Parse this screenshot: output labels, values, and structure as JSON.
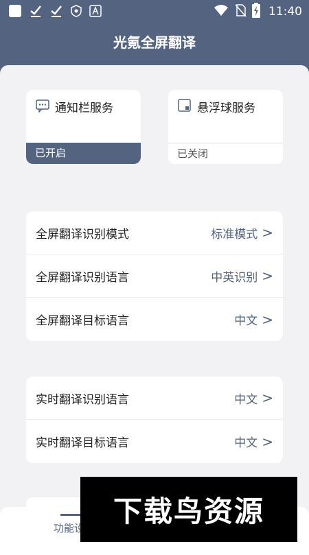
{
  "status_bar": {
    "time": "11:40",
    "left_icons": [
      "square-icon",
      "check-icon",
      "check-icon",
      "shield-icon",
      "a-icon"
    ],
    "right_icons": [
      "wifi-icon",
      "no-sim-icon",
      "battery-charging-icon"
    ]
  },
  "title": "光氪全屏翻译",
  "services": [
    {
      "title": "通知栏服务",
      "status": "已开启",
      "icon": "chat-icon"
    },
    {
      "title": "悬浮球服务",
      "status": "已关闭",
      "icon": "float-ball-icon"
    }
  ],
  "fullscreen_settings": [
    {
      "label": "全屏翻译识别模式",
      "value": "标准模式"
    },
    {
      "label": "全屏翻译识别语言",
      "value": "中英识别"
    },
    {
      "label": "全屏翻译目标语言",
      "value": "中文"
    }
  ],
  "realtime_settings": [
    {
      "label": "实时翻译识别语言",
      "value": "中文"
    },
    {
      "label": "实时翻译目标语言",
      "value": "中文"
    }
  ],
  "chevron": ">",
  "bottom_nav": {
    "tab_label": "功能设"
  },
  "watermark": "下载鸟资源",
  "colors": {
    "primary": "#536380",
    "background": "#f2f2f4",
    "card": "#ffffff"
  }
}
